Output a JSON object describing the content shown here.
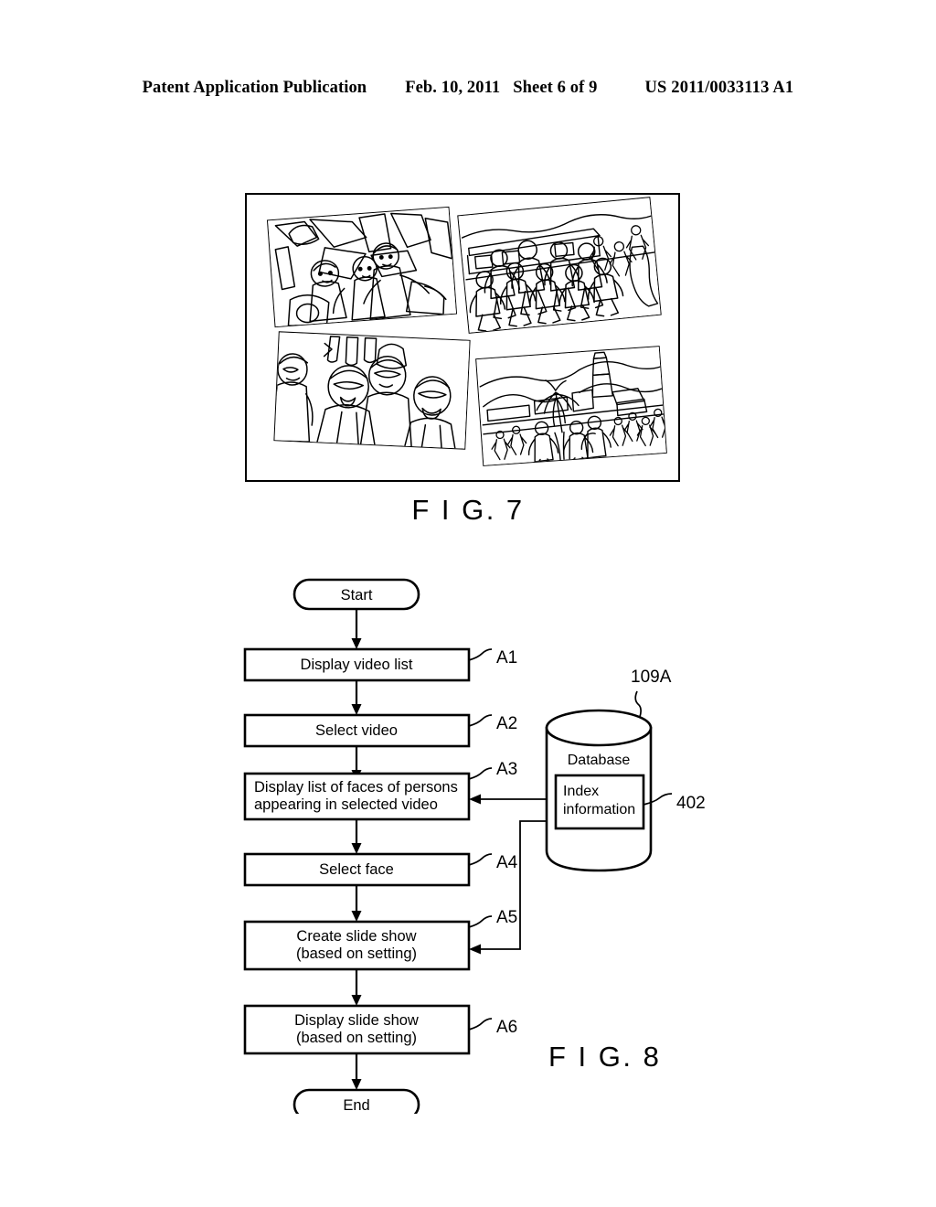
{
  "header": {
    "publication": "Patent Application Publication",
    "date": "Feb. 10, 2011",
    "sheet": "Sheet 6 of 9",
    "number": "US 2011/0033113 A1"
  },
  "figures": [
    {
      "id": "fig7",
      "caption": "F I G. 7",
      "description": "Slide show screen showing four tilted photograph frames of line-art scenes",
      "photos": [
        {
          "name": "photo-top-left",
          "scene": "indoor scene with seated persons and equipment"
        },
        {
          "name": "photo-top-right",
          "scene": "crowd of persons running in a street"
        },
        {
          "name": "photo-bottom-left",
          "scene": "close-up group portrait of four persons"
        },
        {
          "name": "photo-bottom-right",
          "scene": "outdoor townscape with tower, tree and persons"
        }
      ]
    },
    {
      "id": "fig8",
      "caption": "F I G. 8",
      "description": "Flowchart of slide show creation process with database"
    }
  ],
  "flowchart": {
    "start_label": "Start",
    "end_label": "End",
    "steps": [
      {
        "tag": "A1",
        "lines": [
          "Display video list"
        ]
      },
      {
        "tag": "A2",
        "lines": [
          "Select video"
        ]
      },
      {
        "tag": "A3",
        "lines": [
          "Display list of faces of persons",
          "appearing in selected video"
        ]
      },
      {
        "tag": "A4",
        "lines": [
          "Select face"
        ]
      },
      {
        "tag": "A5",
        "lines": [
          "Create slide show",
          "(based on setting)"
        ]
      },
      {
        "tag": "A6",
        "lines": [
          "Display slide show",
          "(based on setting)"
        ]
      }
    ],
    "database": {
      "title": "Database",
      "inner_lines": [
        "Index",
        "information"
      ],
      "ref_cylinder": "109A",
      "ref_inner": "402"
    }
  },
  "colors": {
    "ink": "#000000",
    "paper": "#ffffff"
  }
}
